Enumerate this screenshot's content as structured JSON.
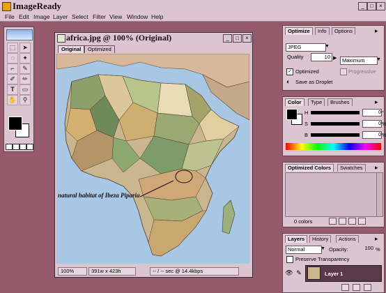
{
  "app": {
    "title": "ImageReady"
  },
  "menu": [
    "File",
    "Edit",
    "Image",
    "Layer",
    "Select",
    "Filter",
    "View",
    "Window",
    "Help"
  ],
  "document": {
    "title": "africa.jpg @ 100% (Original)",
    "tabs": [
      "Original",
      "Optimized"
    ],
    "annotation": "natural habitat of Ibeza Piparia",
    "status": {
      "zoom": "100%",
      "size": "391w x 423h",
      "timing": "-- / -- sec @ 14.4kbps"
    }
  },
  "optimize_panel": {
    "tabs": [
      "Optimize",
      "Info",
      "Options"
    ],
    "format": "JPEG",
    "quality_label": "Quality",
    "quality_value": "10",
    "quality_preset": "Maximum",
    "optimized_label": "Optimized",
    "progressive_label": "Progressive",
    "save_droplet_label": "Save as Droplet"
  },
  "color_panel": {
    "tabs": [
      "Color",
      "Type",
      "Brushes"
    ],
    "channels": [
      "H",
      "S",
      "B"
    ],
    "units": [
      "°",
      "%",
      "%"
    ],
    "values": [
      "0",
      "0",
      "0"
    ]
  },
  "optimized_colors_panel": {
    "tabs": [
      "Optimized Colors",
      "Swatches"
    ],
    "count_label": "0 colors"
  },
  "layers_panel": {
    "tabs": [
      "Layers",
      "History",
      "Actions"
    ],
    "blend_mode": "Normal",
    "opacity_label": "Opacity:",
    "opacity_value": "100",
    "preserve_label": "Preserve Transparency",
    "layer_name": "Layer 1"
  },
  "colors": {
    "desktop": "#94596b",
    "chrome": "#dcc4d0",
    "ocean": "#a7c7e4"
  }
}
